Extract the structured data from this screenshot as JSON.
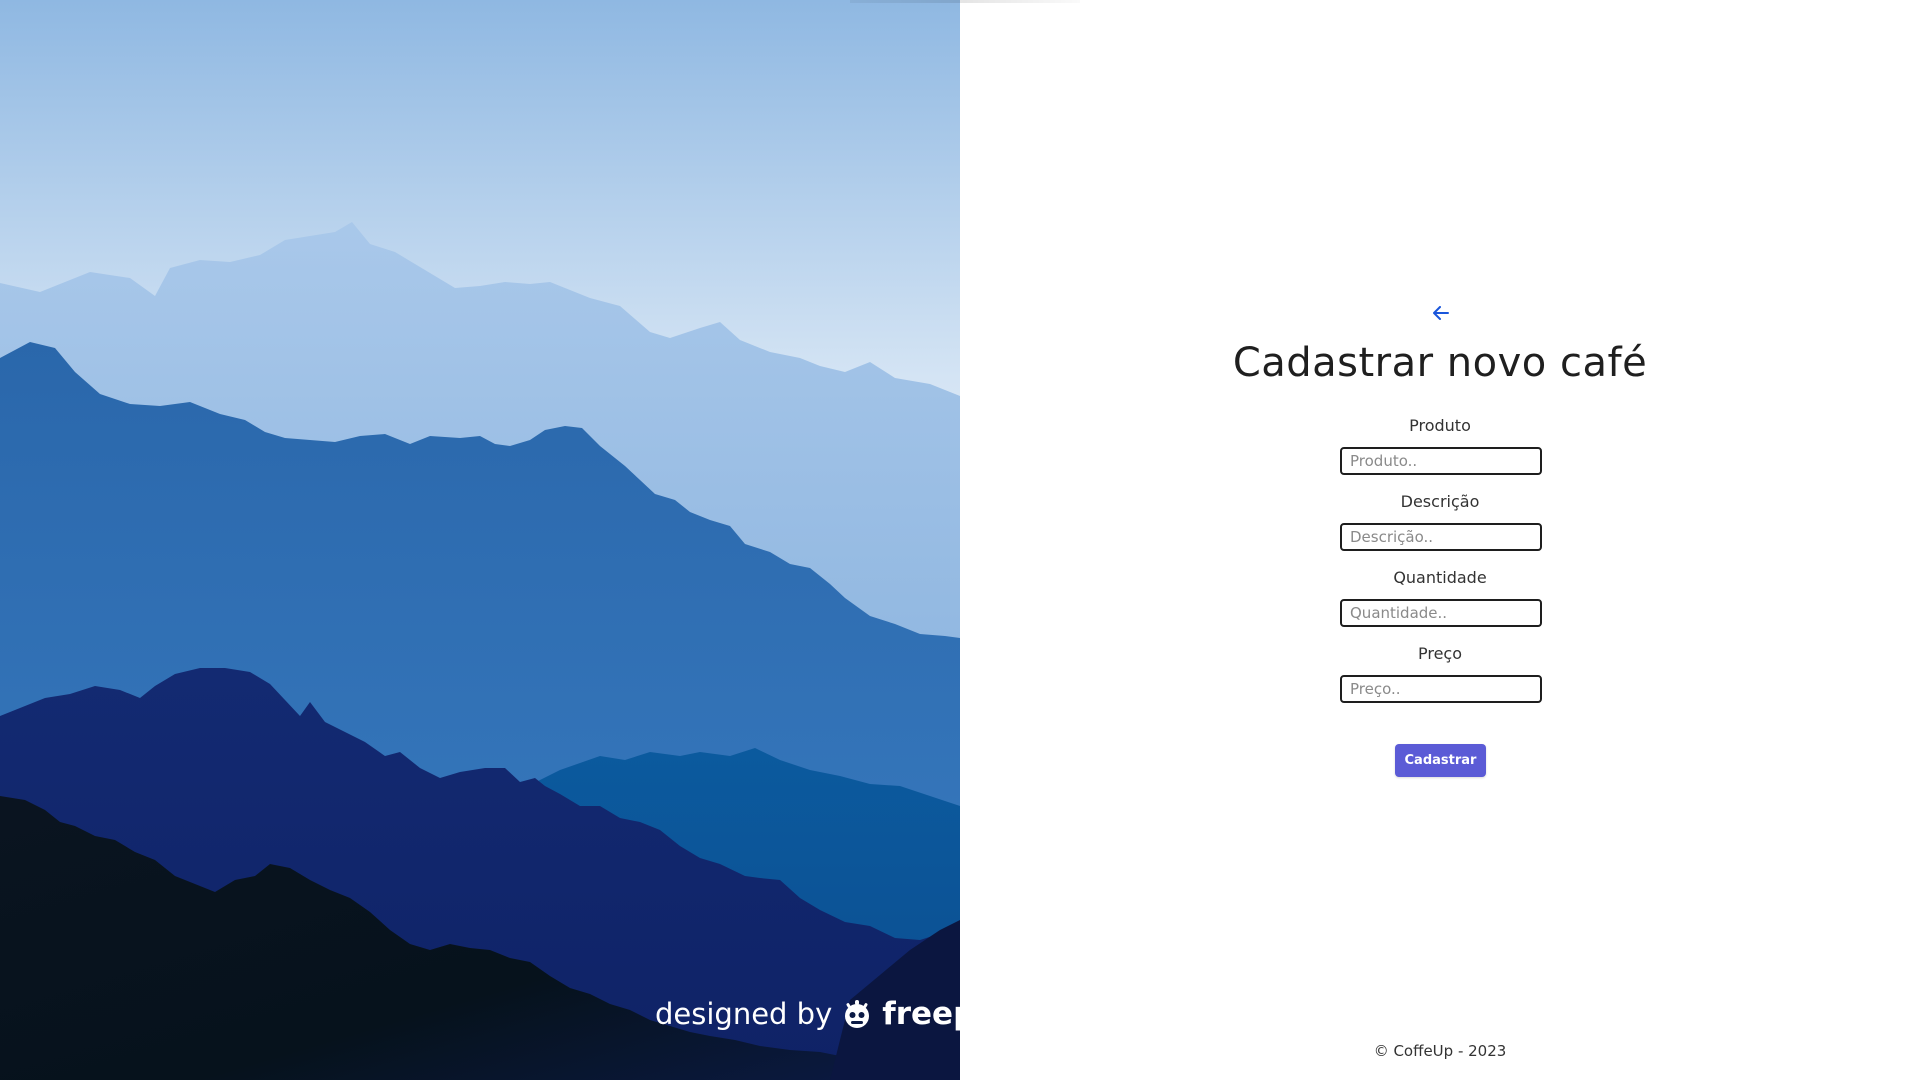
{
  "illustration": {
    "credit_prefix": "designed by",
    "credit_brand": "freepik"
  },
  "nav": {
    "back_icon": "arrow-left-icon",
    "back_color": "#1a56db"
  },
  "form": {
    "title": "Cadastrar novo café",
    "fields": [
      {
        "label": "Produto",
        "placeholder": "Produto..",
        "value": ""
      },
      {
        "label": "Descrição",
        "placeholder": "Descrição..",
        "value": ""
      },
      {
        "label": "Quantidade",
        "placeholder": "Quantidade..",
        "value": ""
      },
      {
        "label": "Preço",
        "placeholder": "Preço..",
        "value": ""
      }
    ],
    "submit_label": "Cadastrar",
    "submit_color": "#5b5bd6"
  },
  "footer": {
    "text": "© CoffeUp - 2023"
  }
}
